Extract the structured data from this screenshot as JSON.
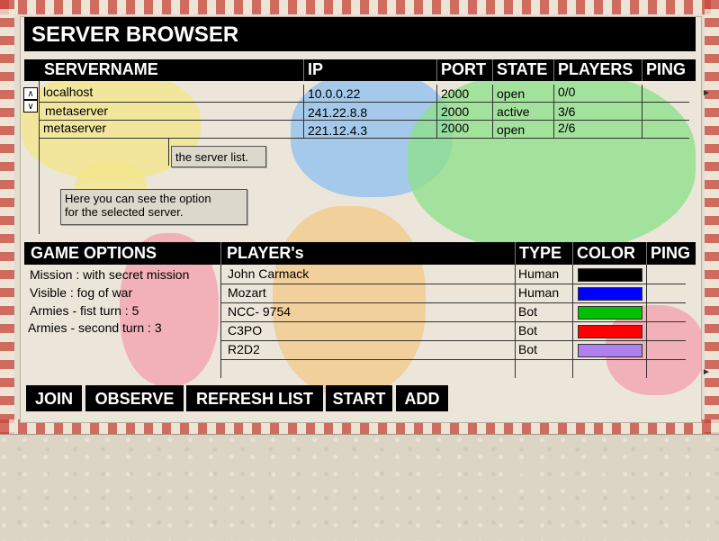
{
  "window": {
    "title": "SERVER BROWSER"
  },
  "server_table": {
    "headers": [
      "SERVERNAME",
      "IP",
      "PORT",
      "STATE",
      "PLAYERS",
      "PING"
    ],
    "rows": [
      {
        "name": "localhost",
        "ip": "10.0.0.22",
        "port": "2000",
        "state": "open",
        "players": "0/0",
        "ping": ""
      },
      {
        "name": "metaserver",
        "ip": "241.22.8.8",
        "port": "2000",
        "state": "active",
        "players": "3/6",
        "ping": ""
      },
      {
        "name": "metaserver",
        "ip": "221.12.4.3",
        "port": "2000",
        "state": "open",
        "players": "2/6",
        "ping": ""
      }
    ],
    "scroll_up_icon": "chevron-up-icon",
    "scroll_down_icon": "chevron-down-icon"
  },
  "tooltips": {
    "server_list": "the server list.",
    "option_line1": "Here you can see the option",
    "option_line2": "for the selected server."
  },
  "game_options": {
    "header": "GAME OPTIONS",
    "items": [
      "Mission : with secret mission",
      "Visible : fog of war",
      "Armies - fist turn : 5",
      "Armies - second turn : 3"
    ]
  },
  "players_table": {
    "headers": [
      "PLAYER's",
      "TYPE",
      "COLOR",
      "PING"
    ],
    "rows": [
      {
        "name": "John Carmack",
        "type": "Human",
        "color": "#000000"
      },
      {
        "name": "Mozart",
        "type": "Human",
        "color": "#0000ff"
      },
      {
        "name": "NCC- 9754",
        "type": "Bot",
        "color": "#00c000"
      },
      {
        "name": "C3PO",
        "type": "Bot",
        "color": "#ff0000"
      },
      {
        "name": "R2D2",
        "type": "Bot",
        "color": "#b080f0"
      }
    ]
  },
  "buttons": {
    "join": "JOIN",
    "observe": "OBSERVE",
    "refresh": "REFRESH LIST",
    "start": "START",
    "add": "ADD"
  },
  "colors": {
    "background": "#e3ddd0",
    "bar": "#000000",
    "bar_text": "#ffffff"
  }
}
